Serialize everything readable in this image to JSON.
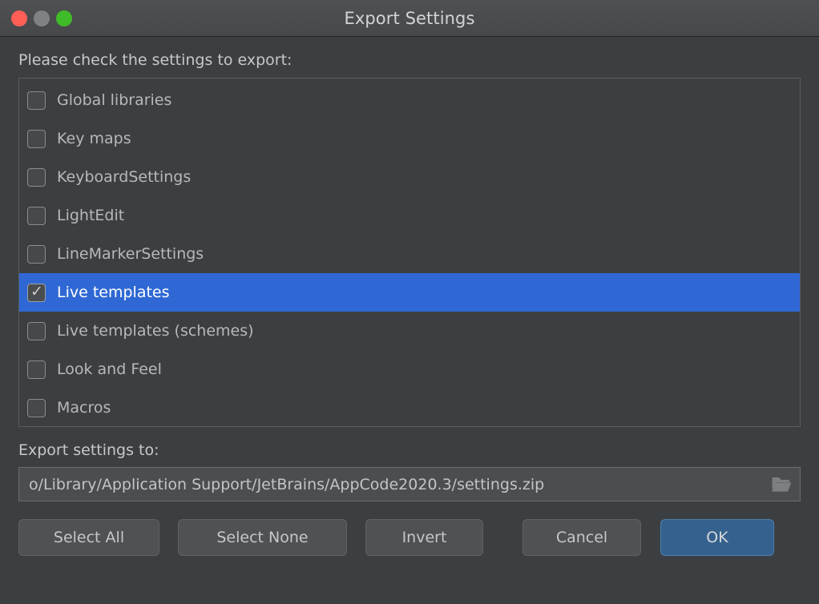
{
  "window": {
    "title": "Export Settings",
    "traffic_lights": [
      "close",
      "minimize",
      "maximize"
    ]
  },
  "instructions": "Please check the settings to export:",
  "settings_list": [
    {
      "label": "Global libraries",
      "checked": false,
      "selected": false
    },
    {
      "label": "Key maps",
      "checked": false,
      "selected": false
    },
    {
      "label": "KeyboardSettings",
      "checked": false,
      "selected": false
    },
    {
      "label": "LightEdit",
      "checked": false,
      "selected": false
    },
    {
      "label": "LineMarkerSettings",
      "checked": false,
      "selected": false
    },
    {
      "label": "Live templates",
      "checked": true,
      "selected": true
    },
    {
      "label": "Live templates (schemes)",
      "checked": false,
      "selected": false
    },
    {
      "label": "Look and Feel",
      "checked": false,
      "selected": false
    },
    {
      "label": "Macros",
      "checked": false,
      "selected": false
    }
  ],
  "export_path": {
    "label": "Export settings to:",
    "value": "o/Library/Application Support/JetBrains/AppCode2020.3/settings.zip",
    "browse_icon": "folder-icon"
  },
  "buttons": {
    "select_all": "Select All",
    "select_none": "Select None",
    "invert": "Invert",
    "cancel": "Cancel",
    "ok": "OK"
  },
  "colors": {
    "dialog_bg": "#3c3f41",
    "titlebar_bg": "#4a4c4e",
    "selection_blue": "#2f68d5",
    "ok_button_blue": "#35618f",
    "text_primary": "#c6c8c9",
    "text_secondary": "#b6b8ba",
    "text_selected": "#ffffff"
  },
  "check_glyph": "✓"
}
